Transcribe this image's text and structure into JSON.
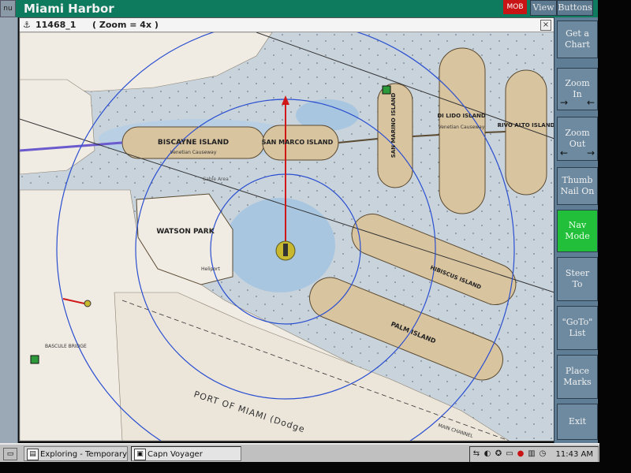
{
  "app": {
    "title": "Miami Harbor",
    "left_button_label": "nu",
    "view_button": "View",
    "buttons_button": "Buttons",
    "red_button": "MOB"
  },
  "chart_window": {
    "title": "11468_1",
    "zoom": "( Zoom = 4x )",
    "close_symbol": "×",
    "labels": {
      "biscayne_island": "BISCAYNE ISLAND",
      "san_marco_island": "SAN MARCO ISLAND",
      "san_marino_island": "SAN MARINO ISLAND",
      "di_lido_island": "DI LIDO ISLAND",
      "rivo_alto_island": "RIVO ALTO ISLAND",
      "venetian_causeway_1": "Venetian Causeway",
      "venetian_causeway_2": "Venetian Causeway",
      "watson_park": "WATSON  PARK",
      "heliport": "Heliport",
      "hibiscus_island": "HIBISCUS ISLAND",
      "palm_island": "PALM ISLAND",
      "port_of_miami": "PORT OF MIAMI (Dodge",
      "main_channel": "MAIN CHANNEL",
      "bascule_bridge": "BASCULE BRIDGE",
      "cable_area": "Cable Area"
    },
    "colors": {
      "water": "#c9d3dc",
      "shallow": "#a9c6e0",
      "land": "#d9c4a0",
      "land_shore": "#f0ebe3",
      "range_ring": "#2a4fd0",
      "heading_line": "#d01818",
      "vessel": "#c8b830"
    }
  },
  "side_buttons": [
    {
      "id": "get-a-chart",
      "label": "Get a\nChart"
    },
    {
      "id": "zoom-in",
      "label": "Zoom\nIn"
    },
    {
      "id": "zoom-out",
      "label": "Zoom\nOut"
    },
    {
      "id": "thumb-nail-on",
      "label": "Thumb\nNail On"
    },
    {
      "id": "nav-mode",
      "label": "Nav\nMode",
      "active": true
    },
    {
      "id": "steer-to",
      "label": "Steer\nTo"
    },
    {
      "id": "goto-list",
      "label": "\"GoTo\"\nList"
    },
    {
      "id": "place-marks",
      "label": "Place\nMarks"
    },
    {
      "id": "exit",
      "label": "Exit"
    }
  ],
  "taskbar": {
    "tasks": [
      {
        "label": "Exploring - Temporary Inter..."
      },
      {
        "label": "Capn Voyager"
      }
    ],
    "clock": "11:43 AM"
  }
}
